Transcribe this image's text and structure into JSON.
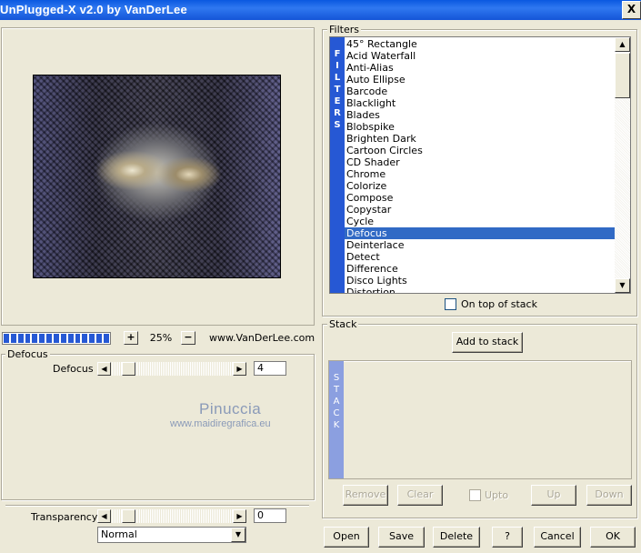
{
  "window": {
    "title": "UnPlugged-X v2.0 by VanDerLee",
    "close_glyph": "X"
  },
  "preview": {
    "zoom_in_label": "+",
    "zoom_out_label": "−",
    "zoom_value": "25%",
    "website": "www.VanDerLee.com",
    "progress_blocks": 15
  },
  "params": {
    "group_label": "Defocus",
    "slider_label": "Defocus",
    "slider_value": "4",
    "slider_fraction": 0.0
  },
  "watermark": {
    "name": "Pinuccia",
    "url": "www.maidiregrafica.eu"
  },
  "bottom_left": {
    "transparency_label": "Transparency",
    "transparency_value": "0",
    "transparency_fraction": 0.0,
    "blend_mode": "Normal"
  },
  "filters": {
    "group_label": "Filters",
    "vertical_label": [
      "F",
      "I",
      "L",
      "T",
      "E",
      "R",
      "S"
    ],
    "items": [
      "45° Rectangle",
      "Acid Waterfall",
      "Anti-Alias",
      "Auto Ellipse",
      "Barcode",
      "Blacklight",
      "Blades",
      "Blobspike",
      "Brighten Dark",
      "Cartoon Circles",
      "CD Shader",
      "Chrome",
      "Colorize",
      "Compose",
      "Copystar",
      "Cycle",
      "Defocus",
      "Deinterlace",
      "Detect",
      "Difference",
      "Disco Lights",
      "Distortion"
    ],
    "selected": "Defocus",
    "on_top_label": "On top of stack",
    "on_top_checked": false
  },
  "stack": {
    "group_label": "Stack",
    "add_label": "Add to stack",
    "vertical_label": [
      "S",
      "T",
      "A",
      "C",
      "K"
    ],
    "remove_label": "Remove",
    "clear_label": "Clear",
    "upto_label": "Upto",
    "up_label": "Up",
    "down_label": "Down"
  },
  "footer": {
    "open_label": "Open",
    "save_label": "Save",
    "delete_label": "Delete",
    "help_label": "?",
    "cancel_label": "Cancel",
    "ok_label": "OK"
  },
  "colors": {
    "accent": "#2658d4",
    "selection": "#316ac5",
    "stack_bar": "#8b9fe0",
    "watermark": "#8a9ab8"
  }
}
